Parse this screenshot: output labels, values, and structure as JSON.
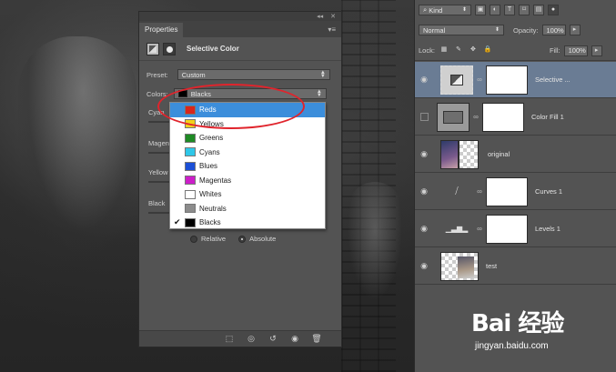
{
  "properties_panel": {
    "tab_title": "Properties",
    "collapse_icon": "double-chevron",
    "close_icon": "x",
    "menu_icon": "panel-menu",
    "adjustment_title": "Selective Color",
    "preset_label": "Preset:",
    "preset_value": "Custom",
    "colors_label": "Colors:",
    "colors_value": "Blacks",
    "sliders": [
      {
        "label": "Cyan"
      },
      {
        "label": "Magen"
      },
      {
        "label": "Yellow"
      },
      {
        "label": "Black"
      }
    ],
    "method": {
      "relative": "Relative",
      "absolute": "Absolute",
      "selected": "Absolute"
    }
  },
  "colors_dropdown": {
    "selected": "Reds",
    "checked": "Blacks",
    "options": [
      {
        "label": "Reds",
        "color": "#d9261c"
      },
      {
        "label": "Yellows",
        "color": "#f2d21b"
      },
      {
        "label": "Greens",
        "color": "#1e8a24"
      },
      {
        "label": "Cyans",
        "color": "#2fc7e8"
      },
      {
        "label": "Blues",
        "color": "#1b4fd6"
      },
      {
        "label": "Magentas",
        "color": "#cc1fc9"
      },
      {
        "label": "Whites",
        "color": "#ffffff"
      },
      {
        "label": "Neutrals",
        "color": "#8c8c8c"
      },
      {
        "label": "Blacks",
        "color": "#000000"
      }
    ]
  },
  "layers_panel": {
    "filter_kind": "Kind",
    "blend_mode": "Normal",
    "opacity_label": "Opacity:",
    "opacity_value": "100%",
    "lock_label": "Lock:",
    "fill_label": "Fill:",
    "fill_value": "100%",
    "layers": [
      {
        "name": "Selective ...",
        "active": true
      },
      {
        "name": "Color Fill 1",
        "active": false
      },
      {
        "name": "original",
        "active": false
      },
      {
        "name": "Curves 1",
        "active": false
      },
      {
        "name": "Levels 1",
        "active": false
      },
      {
        "name": "test",
        "active": false
      }
    ]
  },
  "watermark": {
    "brand": "Bai 经验",
    "url": "jingyan.baidu.com"
  },
  "colors": {
    "highlight_ellipse": "#e0242c",
    "dropdown_selection": "#3c8edb",
    "active_layer": "#6a7c94"
  }
}
